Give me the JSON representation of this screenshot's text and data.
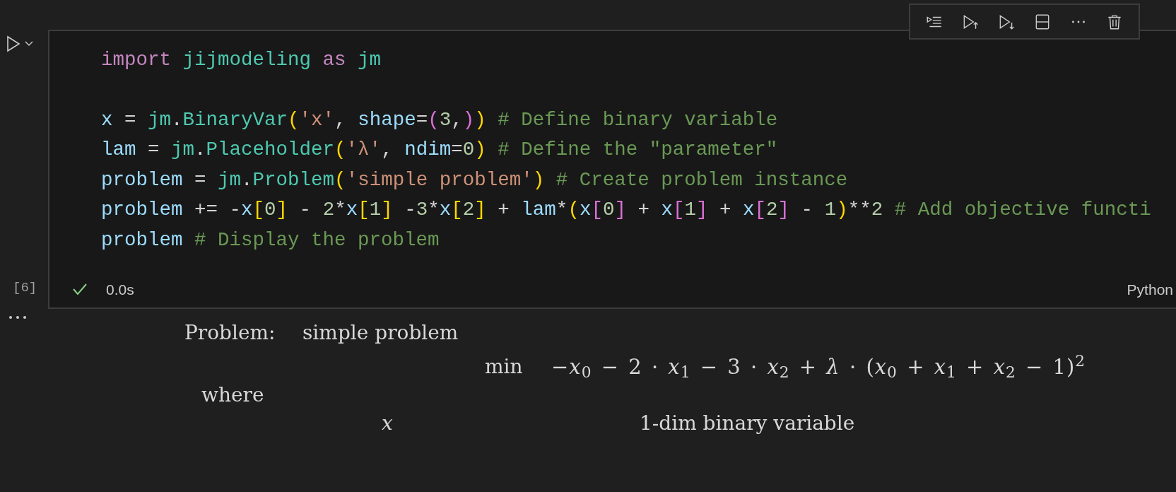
{
  "cell": {
    "execution_count": "[6]",
    "code_blocks": [
      [
        [
          {
            "kind": "kw",
            "text": "import"
          },
          {
            "kind": "cls",
            "text": " jijmodeling"
          },
          {
            "kind": "kw",
            "text": " as"
          },
          {
            "kind": "cls",
            "text": " jm"
          }
        ]
      ],
      [
        [
          {
            "kind": "var",
            "text": "x"
          },
          {
            "kind": "p",
            "text": " = "
          },
          {
            "kind": "cls",
            "text": "jm"
          },
          {
            "kind": "p",
            "text": "."
          },
          {
            "kind": "cls",
            "text": "BinaryVar"
          },
          {
            "kind": "b1",
            "text": "("
          },
          {
            "kind": "str",
            "text": "'x'"
          },
          {
            "kind": "p",
            "text": ","
          },
          {
            "kind": "var",
            "text": " shape"
          },
          {
            "kind": "p",
            "text": "="
          },
          {
            "kind": "b2",
            "text": "("
          },
          {
            "kind": "num",
            "text": "3"
          },
          {
            "kind": "p",
            "text": ","
          },
          {
            "kind": "b2",
            "text": ")"
          },
          {
            "kind": "b1",
            "text": ")"
          },
          {
            "kind": "cmt",
            "text": " # Define binary variable"
          }
        ],
        [
          {
            "kind": "var",
            "text": "lam"
          },
          {
            "kind": "p",
            "text": " = "
          },
          {
            "kind": "cls",
            "text": "jm"
          },
          {
            "kind": "p",
            "text": "."
          },
          {
            "kind": "cls",
            "text": "Placeholder"
          },
          {
            "kind": "b1",
            "text": "("
          },
          {
            "kind": "str",
            "text": "'λ'"
          },
          {
            "kind": "p",
            "text": ","
          },
          {
            "kind": "var",
            "text": " ndim"
          },
          {
            "kind": "p",
            "text": "="
          },
          {
            "kind": "num",
            "text": "0"
          },
          {
            "kind": "b1",
            "text": ")"
          },
          {
            "kind": "cmt",
            "text": " # Define the \"parameter\""
          }
        ],
        [
          {
            "kind": "var",
            "text": "problem"
          },
          {
            "kind": "p",
            "text": " = "
          },
          {
            "kind": "cls",
            "text": "jm"
          },
          {
            "kind": "p",
            "text": "."
          },
          {
            "kind": "cls",
            "text": "Problem"
          },
          {
            "kind": "b1",
            "text": "("
          },
          {
            "kind": "str",
            "text": "'simple problem'"
          },
          {
            "kind": "b1",
            "text": ")"
          },
          {
            "kind": "cmt",
            "text": " # Create problem instance"
          }
        ],
        [
          {
            "kind": "var",
            "text": "problem"
          },
          {
            "kind": "p",
            "text": " += -"
          },
          {
            "kind": "var",
            "text": "x"
          },
          {
            "kind": "b1",
            "text": "["
          },
          {
            "kind": "num",
            "text": "0"
          },
          {
            "kind": "b1",
            "text": "]"
          },
          {
            "kind": "p",
            "text": " - "
          },
          {
            "kind": "num",
            "text": "2"
          },
          {
            "kind": "p",
            "text": "*"
          },
          {
            "kind": "var",
            "text": "x"
          },
          {
            "kind": "b1",
            "text": "["
          },
          {
            "kind": "num",
            "text": "1"
          },
          {
            "kind": "b1",
            "text": "]"
          },
          {
            "kind": "p",
            "text": " -"
          },
          {
            "kind": "num",
            "text": "3"
          },
          {
            "kind": "p",
            "text": "*"
          },
          {
            "kind": "var",
            "text": "x"
          },
          {
            "kind": "b1",
            "text": "["
          },
          {
            "kind": "num",
            "text": "2"
          },
          {
            "kind": "b1",
            "text": "]"
          },
          {
            "kind": "p",
            "text": " + "
          },
          {
            "kind": "var",
            "text": "lam"
          },
          {
            "kind": "p",
            "text": "*"
          },
          {
            "kind": "b1",
            "text": "("
          },
          {
            "kind": "var",
            "text": "x"
          },
          {
            "kind": "b2",
            "text": "["
          },
          {
            "kind": "num",
            "text": "0"
          },
          {
            "kind": "b2",
            "text": "]"
          },
          {
            "kind": "p",
            "text": " + "
          },
          {
            "kind": "var",
            "text": "x"
          },
          {
            "kind": "b2",
            "text": "["
          },
          {
            "kind": "num",
            "text": "1"
          },
          {
            "kind": "b2",
            "text": "]"
          },
          {
            "kind": "p",
            "text": " + "
          },
          {
            "kind": "var",
            "text": "x"
          },
          {
            "kind": "b2",
            "text": "["
          },
          {
            "kind": "num",
            "text": "2"
          },
          {
            "kind": "b2",
            "text": "]"
          },
          {
            "kind": "p",
            "text": " - "
          },
          {
            "kind": "num",
            "text": "1"
          },
          {
            "kind": "b1",
            "text": ")"
          },
          {
            "kind": "p",
            "text": "**"
          },
          {
            "kind": "num",
            "text": "2"
          },
          {
            "kind": "cmt",
            "text": " # Add objective functi"
          }
        ],
        [
          {
            "kind": "var",
            "text": "problem"
          },
          {
            "kind": "cmt",
            "text": " # Display the problem"
          }
        ]
      ]
    ],
    "status": {
      "success": true,
      "duration": "0.0s",
      "language": "Python"
    }
  },
  "output": {
    "problem_label": "Problem:",
    "problem_name": "simple problem",
    "objective_sense": "min",
    "objective": "−*x*$_{0}$ − 2 · *x*$_{1}$ − 3 · *x*$_{2}$ + *λ* · (*x*$_{0}$ + *x*$_{1}$ + *x*$_{2}$ − 1)$^{2}$",
    "where_label": "where",
    "variables": [
      {
        "symbol": "x",
        "description": "1-dim binary variable"
      }
    ]
  }
}
